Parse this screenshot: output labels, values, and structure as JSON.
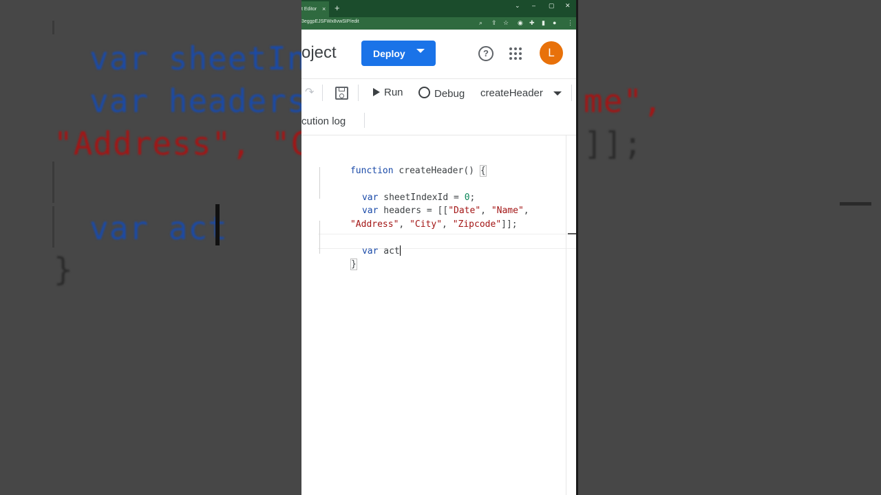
{
  "background": {
    "code_lines": [
      "var sheetInd",
      "var headers",
      "\"Address\", \"Ci",
      "var act",
      "}"
    ],
    "right_fragments": [
      "me\",",
      "]];"
    ]
  },
  "browser": {
    "tab_title": "t Editor",
    "tab_close": "×",
    "new_tab": "+",
    "window_controls": [
      "⌄",
      "–",
      "▢",
      "✕"
    ],
    "url": "3eggpEJSFWx8vwSIP/edit"
  },
  "header": {
    "project_title": "oject",
    "deploy_label": "Deploy",
    "avatar_letter": "L",
    "help_label": "?"
  },
  "toolbar": {
    "run_label": "Run",
    "debug_label": "Debug",
    "function_name": "createHeader"
  },
  "exec": {
    "label": "cution log"
  },
  "code": {
    "line1_kw": "function",
    "line1_rest": " createHeader() ",
    "line1_brace": "{",
    "line3_kw": "var",
    "line3_name": " sheetIndexId = ",
    "line3_num": "0",
    "line3_end": ";",
    "line4_kw": "var",
    "line4_name": " headers = [[",
    "line4_s1": "\"Date\"",
    "line4_sep1": ", ",
    "line4_s2": "\"Name\"",
    "line4_end": ",",
    "line5_s3": "\"Address\"",
    "line5_sep1": ", ",
    "line5_s4": "\"City\"",
    "line5_sep2": ", ",
    "line5_s5": "\"Zipcode\"",
    "line5_end": "]];",
    "line7_kw": "var",
    "line7_rest": " act",
    "line8_brace": "}"
  }
}
